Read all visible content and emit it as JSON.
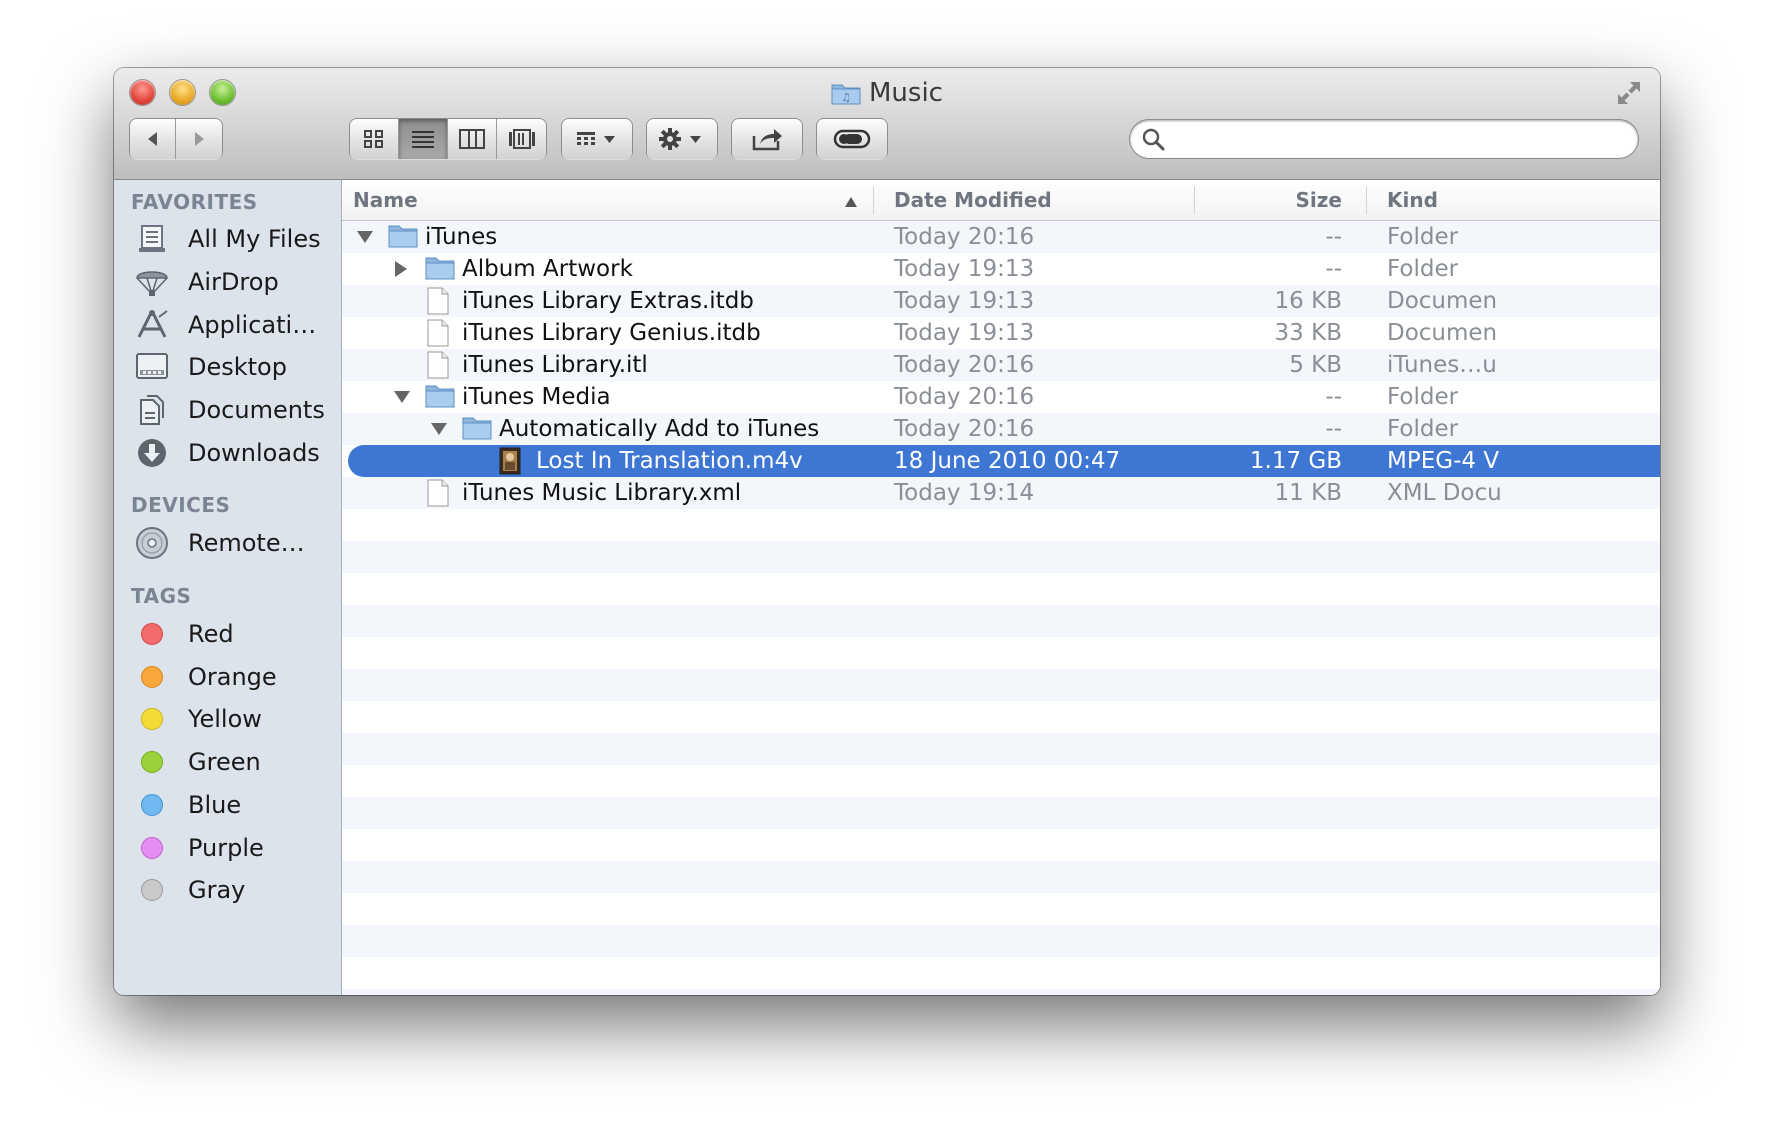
{
  "window": {
    "title": "Music"
  },
  "toolbar": {
    "back": "back",
    "forward": "forward",
    "views": [
      "icon-view",
      "list-view",
      "column-view",
      "coverflow-view"
    ],
    "active_view": "list-view",
    "arrange": "arrange",
    "action": "action",
    "share": "share",
    "tags": "tags",
    "search_value": ""
  },
  "sidebar": {
    "favorites_heading": "FAVORITES",
    "favorites": [
      {
        "label": "All My Files",
        "icon": "all-my-files-icon"
      },
      {
        "label": "AirDrop",
        "icon": "airdrop-icon"
      },
      {
        "label": "Applicati…",
        "icon": "applications-icon"
      },
      {
        "label": "Desktop",
        "icon": "desktop-icon"
      },
      {
        "label": "Documents",
        "icon": "documents-icon"
      },
      {
        "label": "Downloads",
        "icon": "downloads-icon"
      }
    ],
    "devices_heading": "DEVICES",
    "devices": [
      {
        "label": "Remote…",
        "icon": "remote-disc-icon"
      }
    ],
    "tags_heading": "TAGS",
    "tags": [
      {
        "label": "Red",
        "color": "#f26a6a",
        "border": "#d34848"
      },
      {
        "label": "Orange",
        "color": "#f8a73b",
        "border": "#d98718"
      },
      {
        "label": "Yellow",
        "color": "#f4dc37",
        "border": "#cdb514"
      },
      {
        "label": "Green",
        "color": "#9bd13b",
        "border": "#75aa1c"
      },
      {
        "label": "Blue",
        "color": "#6fb9f0",
        "border": "#3f93d2"
      },
      {
        "label": "Purple",
        "color": "#e58ef2",
        "border": "#c25fd0"
      },
      {
        "label": "Gray",
        "color": "#c9c9c9",
        "border": "#9a9a9a"
      }
    ]
  },
  "columns": {
    "name": "Name",
    "date": "Date Modified",
    "size": "Size",
    "kind": "Kind"
  },
  "files": [
    {
      "name": "iTunes",
      "date": "Today 20:16",
      "size": "--",
      "kind": "Folder",
      "type": "folder",
      "level": 0,
      "disclosure": "open"
    },
    {
      "name": "Album Artwork",
      "date": "Today 19:13",
      "size": "--",
      "kind": "Folder",
      "type": "folder",
      "level": 1,
      "disclosure": "closed"
    },
    {
      "name": "iTunes Library Extras.itdb",
      "date": "Today 19:13",
      "size": "16 KB",
      "kind": "Documen",
      "type": "document",
      "level": 1,
      "disclosure": "none"
    },
    {
      "name": "iTunes Library Genius.itdb",
      "date": "Today 19:13",
      "size": "33 KB",
      "kind": "Documen",
      "type": "document",
      "level": 1,
      "disclosure": "none"
    },
    {
      "name": "iTunes Library.itl",
      "date": "Today 20:16",
      "size": "5 KB",
      "kind": "iTunes…u",
      "type": "document",
      "level": 1,
      "disclosure": "none"
    },
    {
      "name": "iTunes Media",
      "date": "Today 20:16",
      "size": "--",
      "kind": "Folder",
      "type": "folder",
      "level": 1,
      "disclosure": "open"
    },
    {
      "name": "Automatically Add to iTunes",
      "date": "Today 20:16",
      "size": "--",
      "kind": "Folder",
      "type": "folder",
      "level": 2,
      "disclosure": "open"
    },
    {
      "name": "Lost In Translation.m4v",
      "date": "18 June 2010 00:47",
      "size": "1.17 GB",
      "kind": "MPEG-4 V",
      "type": "movie",
      "level": 3,
      "disclosure": "none",
      "selected": true
    },
    {
      "name": "iTunes Music Library.xml",
      "date": "Today 19:14",
      "size": "11 KB",
      "kind": "XML Docu",
      "type": "document",
      "level": 1,
      "disclosure": "none"
    }
  ]
}
